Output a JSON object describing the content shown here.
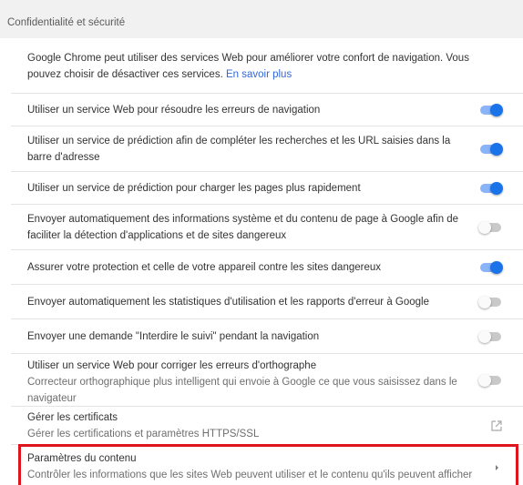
{
  "section": {
    "title": "Confidentialité et sécurité"
  },
  "intro": {
    "text": "Google Chrome peut utiliser des services Web pour améliorer votre confort de navigation. Vous pouvez choisir de désactiver ces services.",
    "link": "En savoir plus"
  },
  "settings": [
    {
      "label": "Utiliser un service Web pour résoudre les erreurs de navigation",
      "state": "on"
    },
    {
      "label": "Utiliser un service de prédiction afin de compléter les recherches et les URL saisies dans la barre d'adresse",
      "state": "on"
    },
    {
      "label": "Utiliser un service de prédiction pour charger les pages plus rapidement",
      "state": "on"
    },
    {
      "label": "Envoyer automatiquement des informations système et du contenu de page à Google afin de faciliter la détection d'applications et de sites dangereux",
      "state": "off"
    },
    {
      "label": "Assurer votre protection et celle de votre appareil contre les sites dangereux",
      "state": "on"
    },
    {
      "label": "Envoyer automatiquement les statistiques d'utilisation et les rapports d'erreur à Google",
      "state": "off"
    },
    {
      "label": "Envoyer une demande \"Interdire le suivi\" pendant la navigation",
      "state": "off"
    },
    {
      "label": "Utiliser un service Web pour corriger les erreurs d'orthographe",
      "sublabel": "Correcteur orthographique plus intelligent qui envoie à Google ce que vous saisissez dans le navigateur",
      "state": "off"
    }
  ],
  "certificates": {
    "label": "Gérer les certificats",
    "sublabel": "Gérer les certifications et paramètres HTTPS/SSL"
  },
  "content_settings": {
    "label": "Paramètres du contenu",
    "sublabel": "Contrôler les informations que les sites Web peuvent utiliser et le contenu qu'ils peuvent afficher"
  },
  "colors": {
    "toggle_on": "#1a73e8",
    "toggle_off": "#fafafa",
    "link": "#3367d6",
    "highlight": "#e0141c"
  },
  "icons": {
    "certificates": "open-in-new-icon",
    "content_settings": "chevron-right-icon"
  }
}
